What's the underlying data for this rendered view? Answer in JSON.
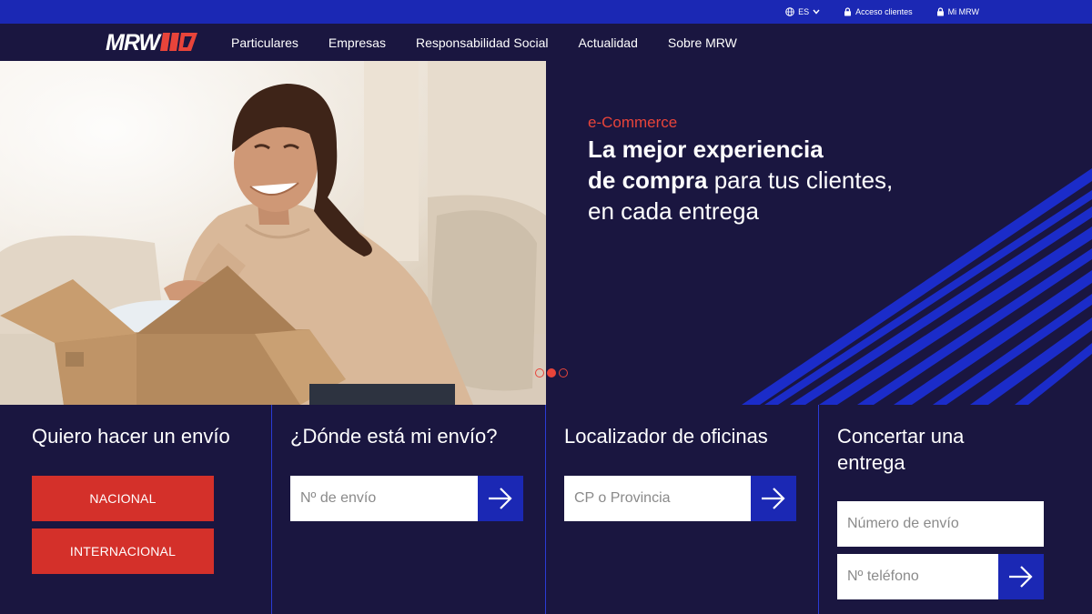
{
  "topbar": {
    "language": "ES",
    "client_access": "Acceso clientes",
    "my_mrw": "Mi MRW"
  },
  "brand": {
    "logo_text": "MRW"
  },
  "nav": {
    "items": [
      "Particulares",
      "Empresas",
      "Responsabilidad Social",
      "Actualidad",
      "Sobre MRW"
    ]
  },
  "hero": {
    "kicker": "e-Commerce",
    "line1_bold": "La mejor experiencia",
    "line2_bold": "de compra",
    "line2_rest": " para tus clientes,",
    "line3": "en cada entrega",
    "slides": 3,
    "active_slide": 2
  },
  "panels": {
    "send": {
      "title": "Quiero hacer un envío",
      "national": "NACIONAL",
      "international": "INTERNACIONAL"
    },
    "track": {
      "title": "¿Dónde está mi envío?",
      "placeholder": "Nº de envío"
    },
    "offices": {
      "title": "Localizador de oficinas",
      "placeholder": "CP o Provincia"
    },
    "delivery": {
      "title_line1": "Concertar una",
      "title_line2": "entrega",
      "placeholder_number": "Número de envío",
      "placeholder_phone": "Nº teléfono"
    }
  },
  "colors": {
    "topbar": "#1b28b4",
    "background": "#1a1640",
    "accent_red": "#d4302a",
    "accent_blue": "#1b28b4"
  }
}
